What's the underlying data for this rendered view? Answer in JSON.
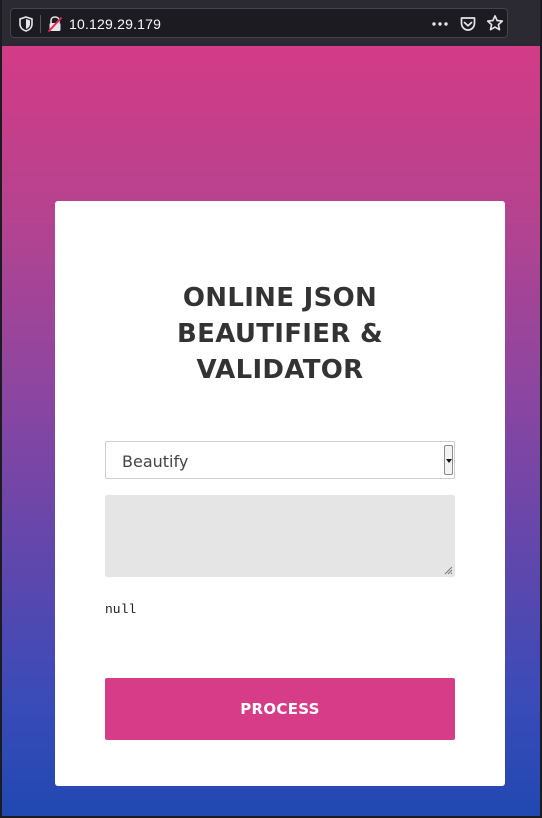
{
  "browser": {
    "url": "10.129.29.179",
    "icons": {
      "shield": "shield-icon",
      "insecure_lock": "insecure-lock-icon",
      "more": "more-dots-icon",
      "pocket": "pocket-icon",
      "bookmark": "bookmark-star-icon"
    }
  },
  "page": {
    "title_lines": [
      "ONLINE JSON",
      "BEAUTIFIER &",
      "VALIDATOR"
    ],
    "mode_select": {
      "selected": "Beautify"
    },
    "input": {
      "value": ""
    },
    "output_text": "null",
    "process_label": "PROCESS",
    "colors": {
      "gradient_top": "#d33b86",
      "gradient_bottom": "#2148b2",
      "button": "#d63c88",
      "title": "#333333"
    }
  }
}
